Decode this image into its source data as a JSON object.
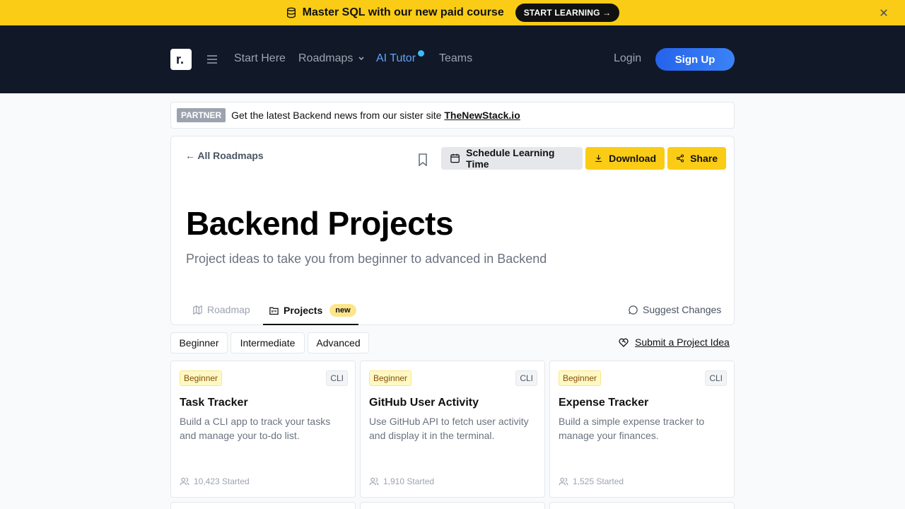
{
  "banner": {
    "icon": "database-icon",
    "text": "Master SQL with our new paid course",
    "cta": "START LEARNING →"
  },
  "nav": {
    "logo_letter": "r.",
    "links": {
      "start_here": "Start Here",
      "roadmaps": "Roadmaps",
      "ai_tutor": "AI Tutor",
      "teams": "Teams"
    },
    "login": "Login",
    "signup": "Sign Up"
  },
  "partner": {
    "badge": "PARTNER",
    "text": "Get the latest Backend news from our sister site",
    "link": "TheNewStack.io"
  },
  "header": {
    "back": "← All Roadmaps",
    "schedule": "Schedule Learning Time",
    "download": "Download",
    "share": "Share",
    "title": "Backend Projects",
    "subtitle": "Project ideas to take you from beginner to advanced in Backend"
  },
  "tabs": {
    "roadmap": "Roadmap",
    "projects": "Projects",
    "projects_badge": "new",
    "suggest": "Suggest Changes"
  },
  "filters": [
    "Beginner",
    "Intermediate",
    "Advanced"
  ],
  "submit_idea": "Submit a Project Idea",
  "projects": [
    {
      "level": "Beginner",
      "tag": "CLI",
      "title": "Task Tracker",
      "desc": "Build a CLI app to track your tasks and manage your to-do list.",
      "started": "10,423 Started"
    },
    {
      "level": "Beginner",
      "tag": "CLI",
      "title": "GitHub User Activity",
      "desc": "Use GitHub API to fetch user activity and display it in the terminal.",
      "started": "1,910 Started"
    },
    {
      "level": "Beginner",
      "tag": "CLI",
      "title": "Expense Tracker",
      "desc": "Build a simple expense tracker to manage your finances.",
      "started": "1,525 Started"
    }
  ],
  "colors": {
    "banner_bg": "#facc15",
    "nav_bg": "#111827",
    "accent_blue": "#2563eb",
    "accent_yellow": "#facc15"
  }
}
